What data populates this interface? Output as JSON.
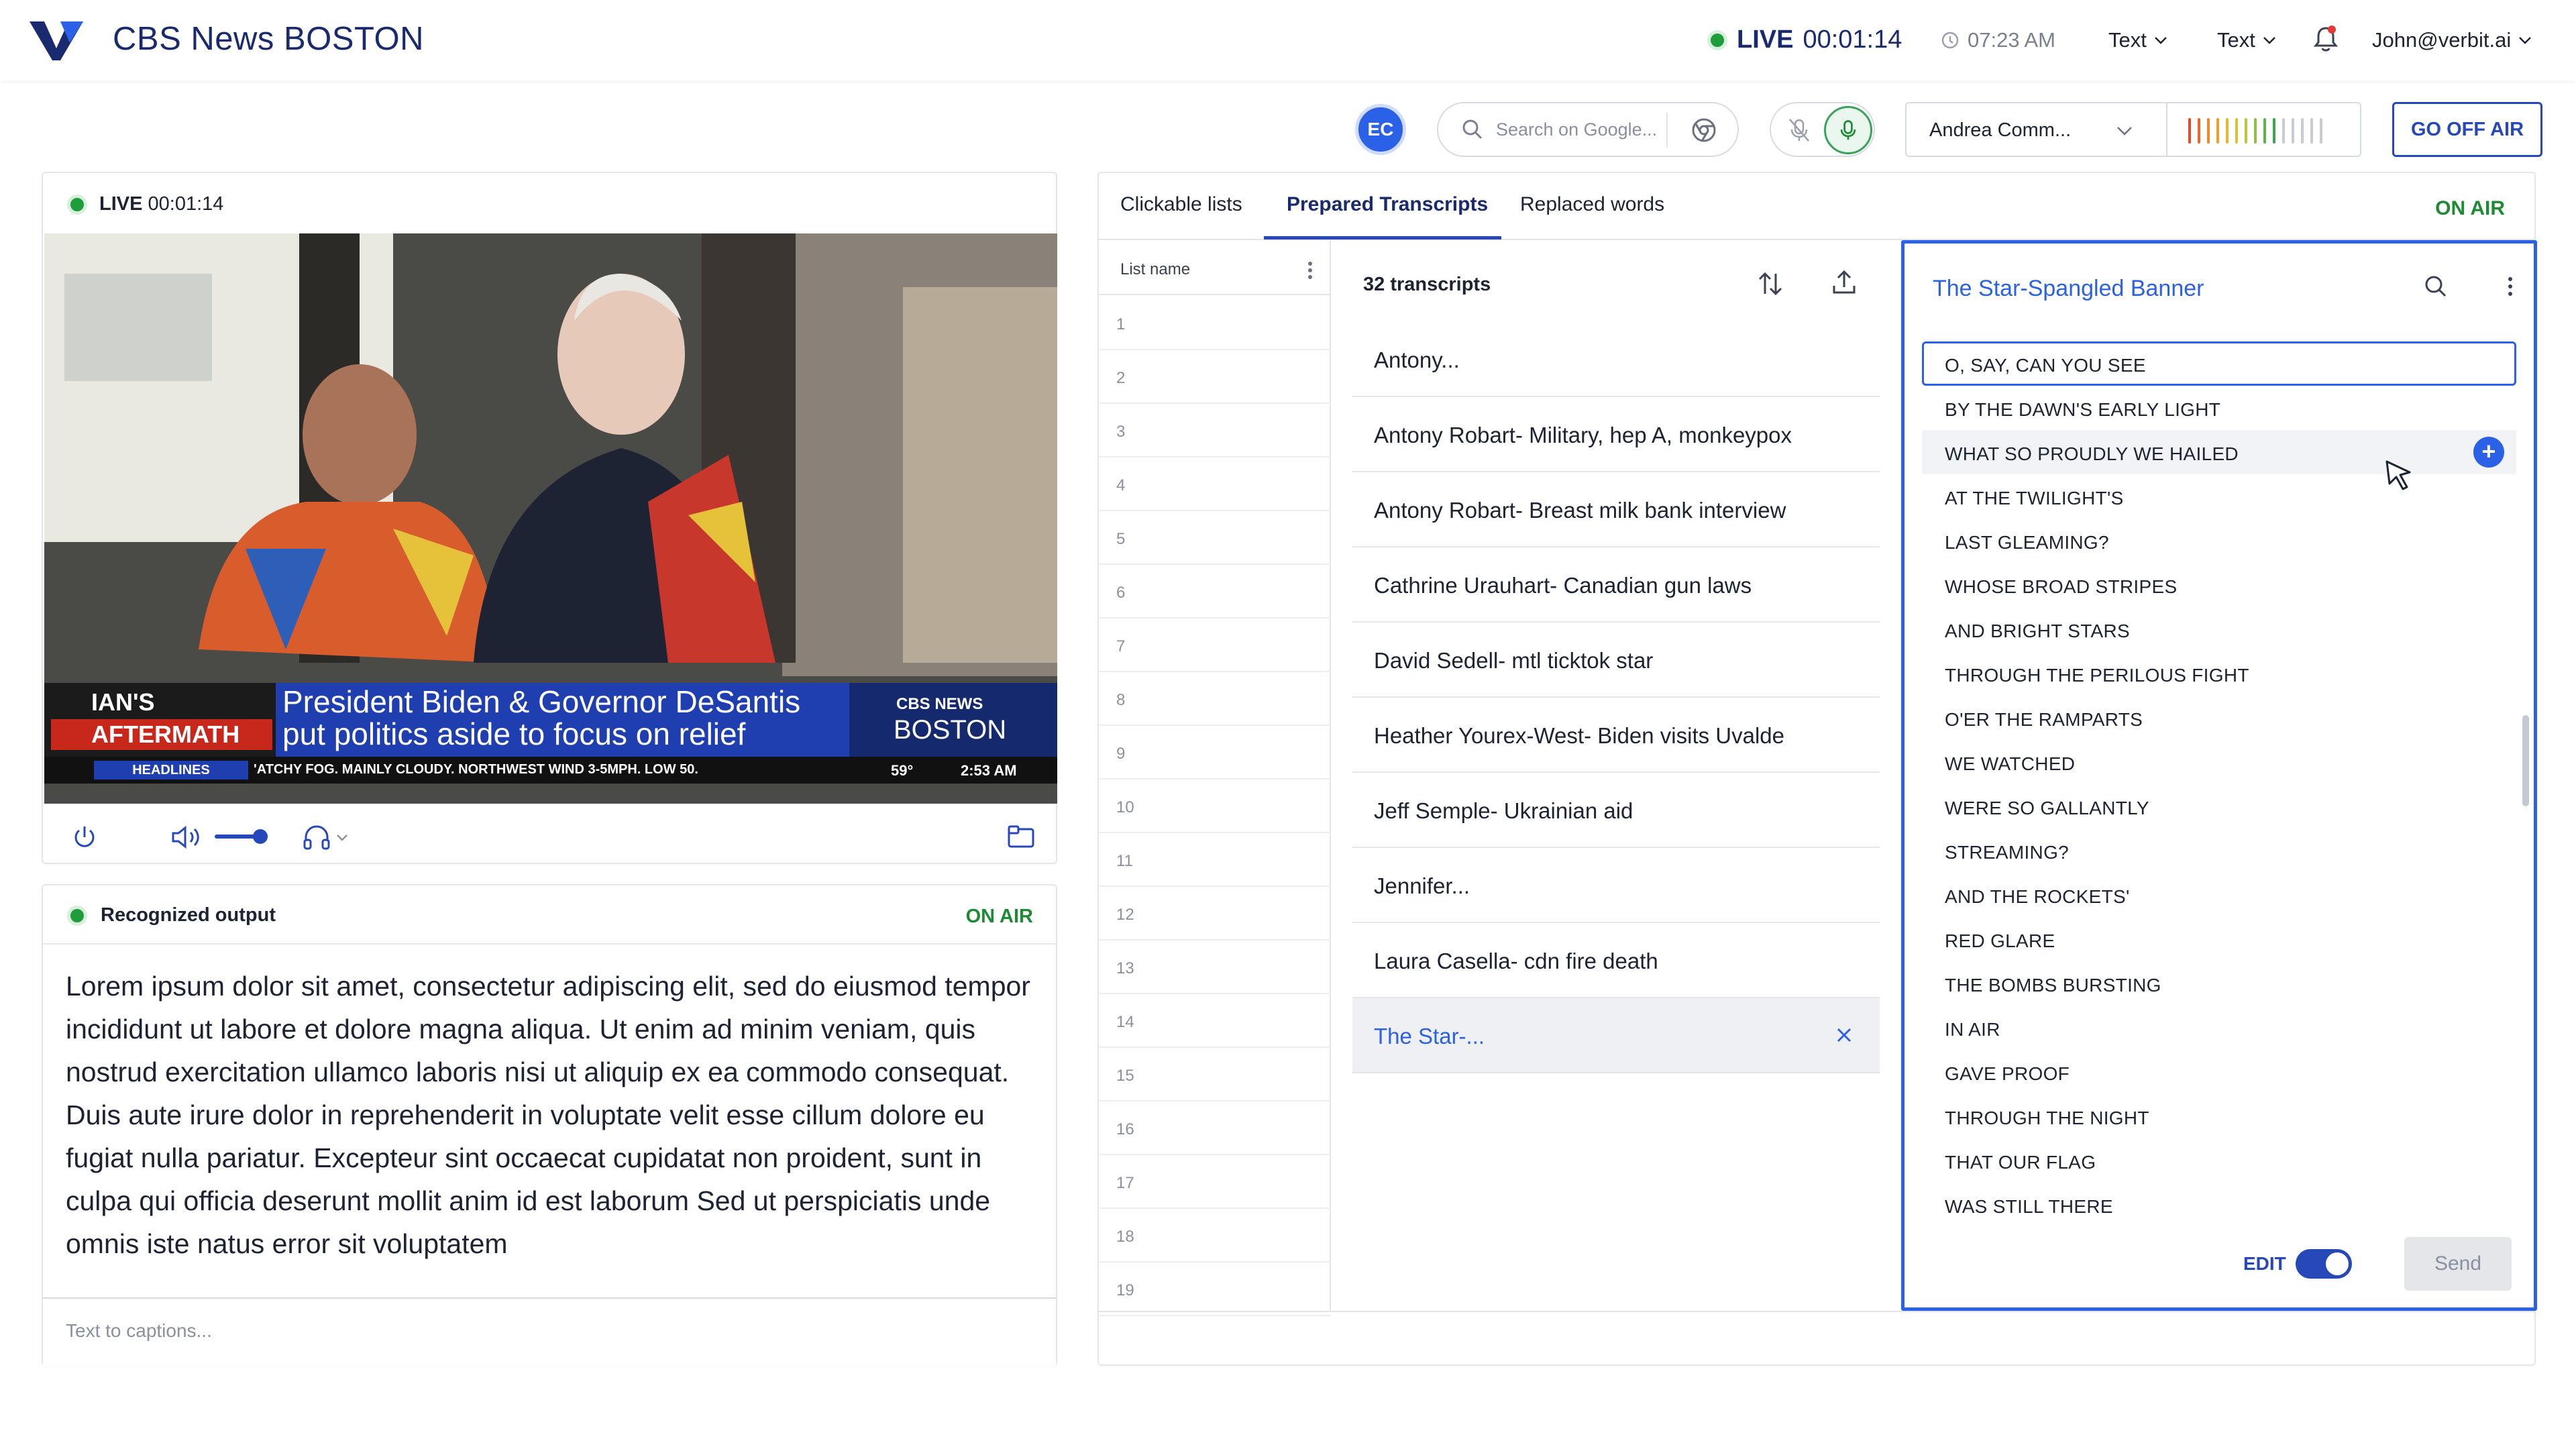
{
  "header": {
    "app_title": "CBS News BOSTON",
    "live_label": "LIVE",
    "live_timer": "00:01:14",
    "clock": "07:23 AM",
    "dropdown_1": "Text",
    "dropdown_2": "Text",
    "user": "John@verbit.ai"
  },
  "toolbar": {
    "avatar_initials": "EC",
    "search_placeholder": "Search on Google...",
    "speaker_name": "Andrea Comm...",
    "go_off_air": "GO OFF AIR"
  },
  "video_panel": {
    "live_label": "LIVE",
    "timer": "00:01:14",
    "lower_third": {
      "tag_top": "IAN'S",
      "tag_bottom": "AFTERMATH",
      "headline_1": "President Biden & Governor DeSantis",
      "headline_2": "put politics aside to focus on relief",
      "network": "CBS NEWS",
      "station": "BOSTON",
      "ticker_label": "HEADLINES",
      "ticker_text": "'ATCHY FOG. MAINLY CLOUDY. NORTHWEST WIND 3-5MPH. LOW 50.",
      "temp": "59°",
      "time": "2:53 AM"
    },
    "volume_level": 0.85
  },
  "output_panel": {
    "title": "Recognized output",
    "status": "ON AIR",
    "text": "Lorem ipsum dolor sit amet, consectetur adipiscing elit, sed do eiusmod tempor incididunt ut labore et dolore magna aliqua. Ut enim ad minim veniam, quis nostrud exercitation ullamco laboris nisi ut aliquip ex ea commodo consequat. Duis aute irure dolor in reprehenderit in voluptate velit esse cillum dolore eu fugiat nulla pariatur. Excepteur sint occaecat cupidatat non proident, sunt in culpa qui officia deserunt mollit anim id est laborum Sed ut perspiciatis unde omnis iste natus error sit voluptatem",
    "input_placeholder": "Text to captions..."
  },
  "right_panel": {
    "tabs": [
      "Clickable lists",
      "Prepared Transcripts",
      "Replaced words"
    ],
    "active_tab": "Prepared Transcripts",
    "status": "ON AIR",
    "list": {
      "header": "List name",
      "rows": [
        "1",
        "2",
        "3",
        "4",
        "5",
        "6",
        "7",
        "8",
        "9",
        "10",
        "11",
        "12",
        "13",
        "14",
        "15",
        "16",
        "17",
        "18",
        "19"
      ]
    },
    "transcripts": {
      "count": "32 transcripts",
      "items": [
        "Antony...",
        "Antony Robart- Military, hep A, monkeypox",
        "Antony Robart- Breast milk bank interview",
        "Cathrine Urauhart- Canadian gun laws",
        "David Sedell- mtl ticktok star",
        "Heather Yourex-West- Biden visits Uvalde",
        "Jeff Semple- Ukrainian aid",
        "Jennifer...",
        "Laura Casella- cdn fire death",
        "The Star-..."
      ]
    },
    "detail": {
      "title": "The Star-Spangled Banner",
      "lines": [
        "O, SAY, CAN YOU SEE",
        "BY THE DAWN'S EARLY LIGHT",
        "WHAT SO PROUDLY WE HAILED",
        "AT THE TWILIGHT'S",
        "LAST GLEAMING?",
        "WHOSE BROAD STRIPES",
        "AND BRIGHT STARS",
        "THROUGH THE PERILOUS FIGHT",
        "O'ER THE RAMPARTS",
        "WE WATCHED",
        "WERE SO GALLANTLY",
        "STREAMING?",
        "AND THE ROCKETS'",
        "RED GLARE",
        "THE BOMBS BURSTING",
        "IN AIR",
        "GAVE PROOF",
        "THROUGH THE NIGHT",
        "THAT OUR FLAG",
        "WAS STILL THERE"
      ],
      "edit_label": "EDIT",
      "edit_on": true,
      "send_label": "Send"
    }
  },
  "colors": {
    "brand": "#1a2a6e",
    "accent": "#2a61e6",
    "live_green": "#1f9d3a"
  }
}
